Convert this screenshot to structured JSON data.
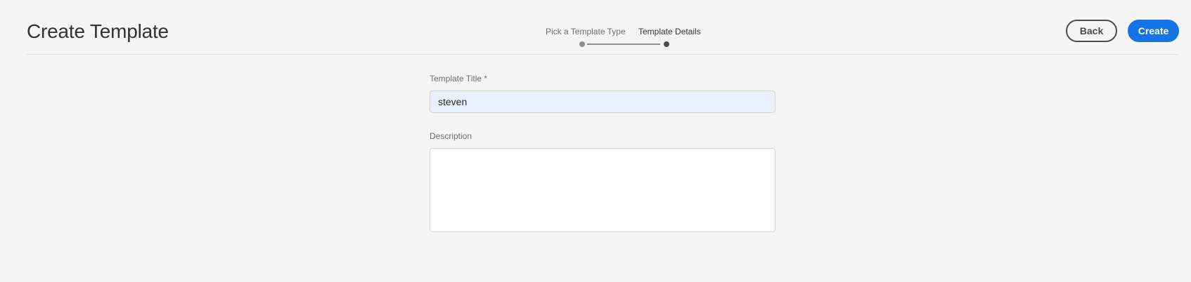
{
  "header": {
    "title": "Create Template"
  },
  "wizard": {
    "steps": [
      {
        "label": "Pick a Template Type",
        "status": "completed"
      },
      {
        "label": "Template Details",
        "status": "current"
      }
    ]
  },
  "actions": {
    "back_label": "Back",
    "create_label": "Create"
  },
  "form": {
    "title_label": "Template Title *",
    "title_value": "steven",
    "description_label": "Description",
    "description_value": ""
  },
  "colors": {
    "accent": "#1473e6",
    "background": "#f5f5f5",
    "autofill": "#e8f0fe"
  }
}
